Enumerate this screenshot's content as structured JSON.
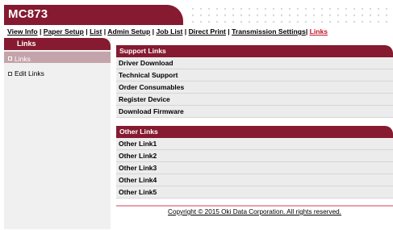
{
  "header": {
    "title": "MC873"
  },
  "topnav": {
    "items": [
      {
        "label": "View Info"
      },
      {
        "label": "Paper Setup"
      },
      {
        "label": "List"
      },
      {
        "label": "Admin Setup"
      },
      {
        "label": "Job List"
      },
      {
        "label": "Direct Print"
      },
      {
        "label": "Transmission Settings"
      },
      {
        "label": "Links"
      }
    ],
    "separator": " | ",
    "last_separator": "| "
  },
  "sidebar": {
    "title": "Links",
    "items": [
      {
        "label": "Links",
        "selected": true
      },
      {
        "label": "Edit Links",
        "selected": false
      }
    ]
  },
  "support_links": {
    "title": "Support Links",
    "items": [
      "Driver Download",
      "Technical Support",
      "Order Consumables",
      "Register Device",
      "Download Firmware"
    ]
  },
  "other_links": {
    "title": "Other Links",
    "items": [
      "Other Link1",
      "Other Link2",
      "Other Link3",
      "Other Link4",
      "Other Link5"
    ]
  },
  "footer": {
    "copyright": "Copyright © 2015 Oki Data Corporation. All rights reserved."
  },
  "colors": {
    "brand": "#851a30",
    "active_link": "#c0122a",
    "selected_sidebar": "#c4a4ab"
  }
}
